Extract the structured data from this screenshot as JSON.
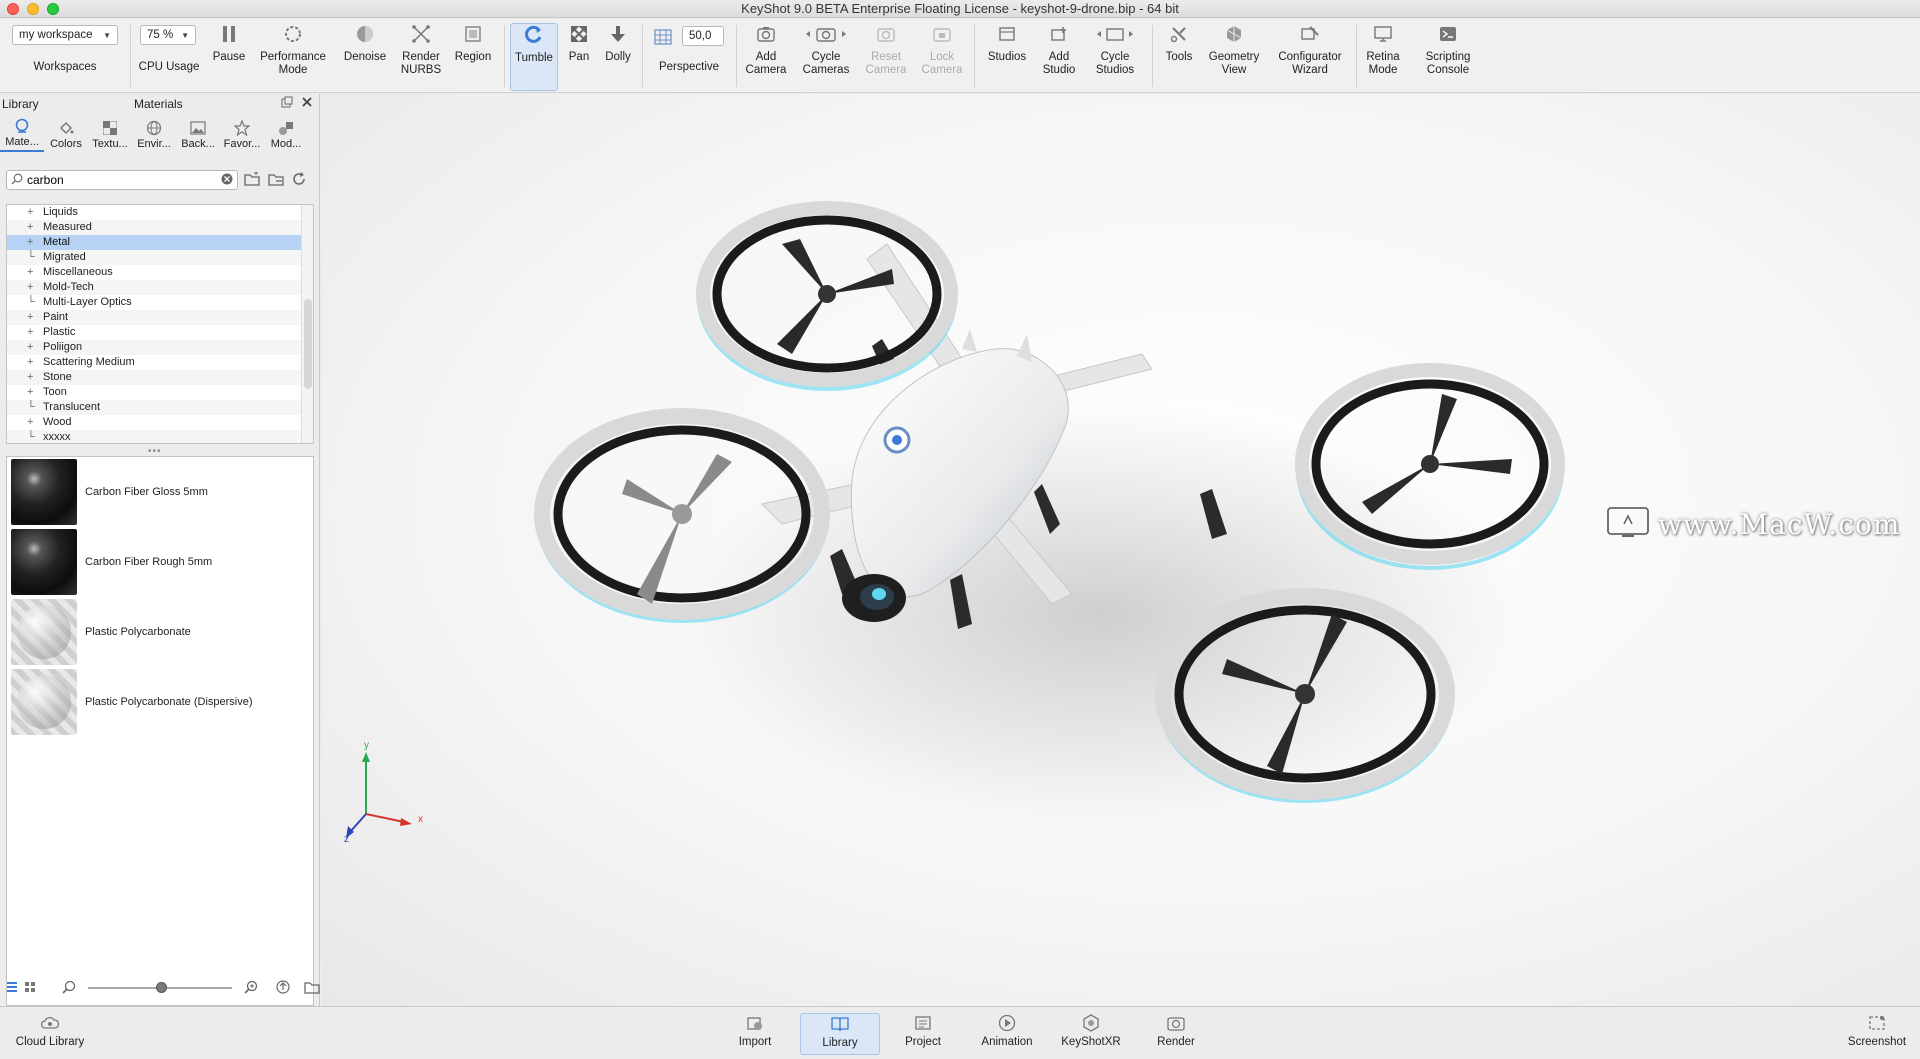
{
  "window": {
    "title": "KeyShot 9.0 BETA Enterprise Floating License  - keyshot-9-drone.bip  - 64 bit"
  },
  "toolbar": {
    "workspace_value": "my workspace",
    "workspaces_label": "Workspaces",
    "cpu_value": "75 %",
    "cpu_label": "CPU Usage",
    "pause": "Pause",
    "performance_1": "Performance",
    "performance_2": "Mode",
    "denoise": "Denoise",
    "render_1": "Render",
    "render_2": "NURBS",
    "region": "Region",
    "tumble": "Tumble",
    "pan": "Pan",
    "dolly": "Dolly",
    "fov_value": "50,0",
    "perspective": "Perspective",
    "add_camera_1": "Add",
    "add_camera_2": "Camera",
    "cycle_cameras_1": "Cycle",
    "cycle_cameras_2": "Cameras",
    "reset_camera_1": "Reset",
    "reset_camera_2": "Camera",
    "lock_camera_1": "Lock",
    "lock_camera_2": "Camera",
    "studios": "Studios",
    "add_studio_1": "Add",
    "add_studio_2": "Studio",
    "cycle_studios_1": "Cycle",
    "cycle_studios_2": "Studios",
    "tools": "Tools",
    "geometry_1": "Geometry",
    "geometry_2": "View",
    "configurator_1": "Configurator",
    "configurator_2": "Wizard",
    "retina_1": "Retina",
    "retina_2": "Mode",
    "scripting_1": "Scripting",
    "scripting_2": "Console"
  },
  "library": {
    "title": "Library",
    "subtitle": "Materials",
    "tabs": [
      "Mate...",
      "Colors",
      "Textu...",
      "Envir...",
      "Back...",
      "Favor...",
      "Mod..."
    ],
    "search_value": "carbon",
    "tree": [
      "Liquids",
      "Measured",
      "Metal",
      "Migrated",
      "Miscellaneous",
      "Mold-Tech",
      "Multi-Layer Optics",
      "Paint",
      "Plastic",
      "Poliigon",
      "Scattering Medium",
      "Stone",
      "Toon",
      "Translucent",
      "Wood",
      "xxxxx"
    ],
    "results": [
      "Carbon Fiber Gloss 5mm",
      "Carbon Fiber Rough 5mm",
      "Plastic Polycarbonate",
      "Plastic Polycarbonate (Dispersive)"
    ],
    "thumb_size_fraction": 0.45
  },
  "viewport": {
    "watermark": "www.MacW.com",
    "axis_y": "y",
    "axis_x": "x",
    "axis_z": "z"
  },
  "bottombar": {
    "cloud_library": "Cloud Library",
    "import": "Import",
    "library": "Library",
    "project": "Project",
    "animation": "Animation",
    "keyshotxr": "KeyShotXR",
    "render": "Render",
    "screenshot": "Screenshot"
  },
  "colors": {
    "accent": "#3b7bd6",
    "selection": "#b6d3f5",
    "drone_glow": "#5fd7f0"
  }
}
